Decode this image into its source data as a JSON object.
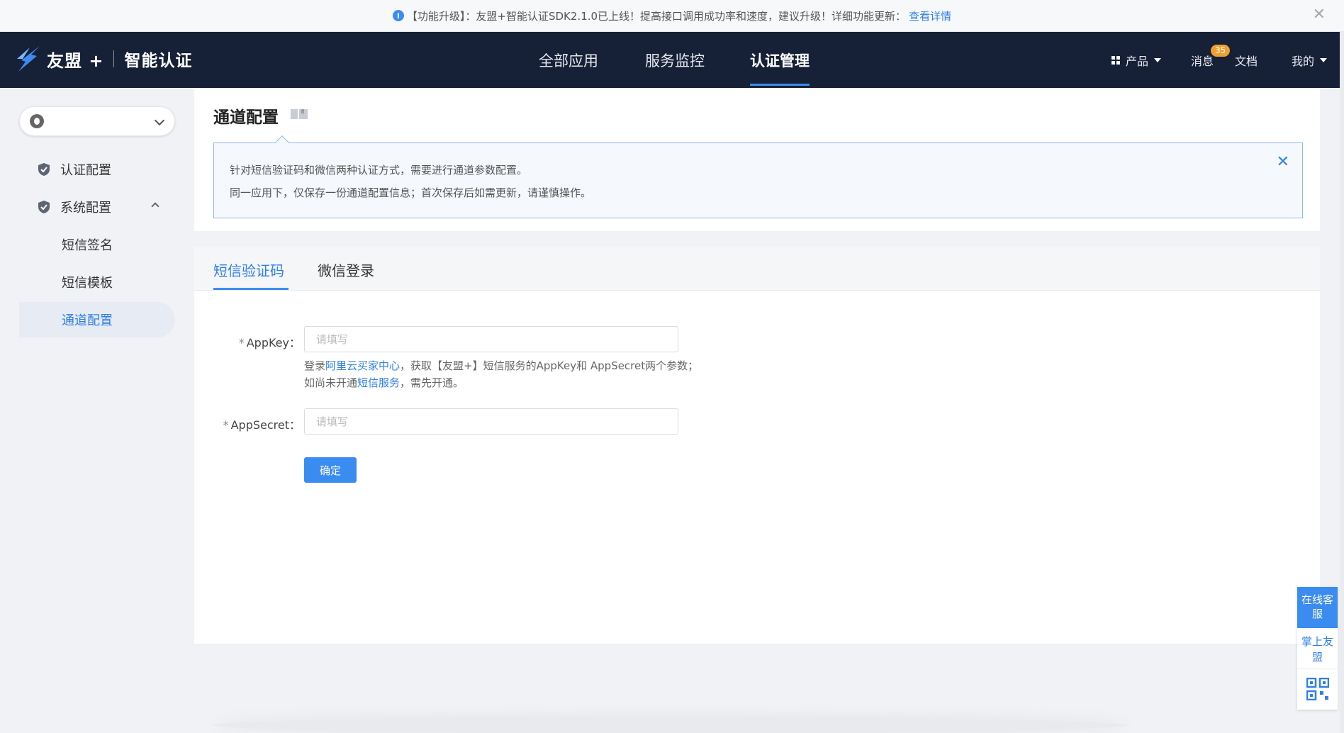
{
  "notice": {
    "text": "【功能升级】：友盟+智能认证SDK2.1.0已上线！提高接口调用成功率和速度，建议升级！详细功能更新：",
    "link": "查看详情",
    "close": "✕"
  },
  "navbar": {
    "logo_text": "友盟 +",
    "logo_sub": "智能认证",
    "items": [
      "全部应用",
      "服务监控",
      "认证管理"
    ],
    "active_item": "认证管理",
    "product": "产品",
    "messages": "消息",
    "message_count": "35",
    "docs": "文档",
    "mine": "我的"
  },
  "sidebar": {
    "items": [
      {
        "label": "认证配置"
      },
      {
        "label": "系统配置"
      }
    ],
    "sub_items": [
      {
        "label": "短信签名"
      },
      {
        "label": "短信模板"
      },
      {
        "label": "通道配置"
      }
    ],
    "active_sub": "通道配置"
  },
  "header": {
    "title": "通道配置",
    "tip_lines": [
      "针对短信验证码和微信两种认证方式，需要进行通道参数配置。",
      "同一应用下，仅保存一份通道配置信息；首次保存后如需更新，请谨慎操作。"
    ],
    "tip_close": "✕"
  },
  "tabs": [
    {
      "label": "短信验证码",
      "active": true
    },
    {
      "label": "微信登录",
      "active": false
    }
  ],
  "form": {
    "appkey_label": "AppKey：",
    "appkey_placeholder": "请填写",
    "help_line1_pre": "登录",
    "help_line1_link": "阿里云买家中心",
    "help_line1_post": "，获取【友盟+】短信服务的AppKey和 AppSecret两个参数；",
    "help_line2_pre": "如尚未开通",
    "help_line2_link": "短信服务",
    "help_line2_post": "，需先开通。",
    "appsecret_label": "AppSecret：",
    "appsecret_placeholder": "请填写",
    "required_mark": "*",
    "submit": "确定"
  },
  "float": {
    "online_service": "在线客服",
    "mobile_app": "掌上友盟"
  },
  "colors": {
    "accent": "#3b8cf0",
    "nav_bg": "#162036",
    "badge": "#f0a030"
  }
}
